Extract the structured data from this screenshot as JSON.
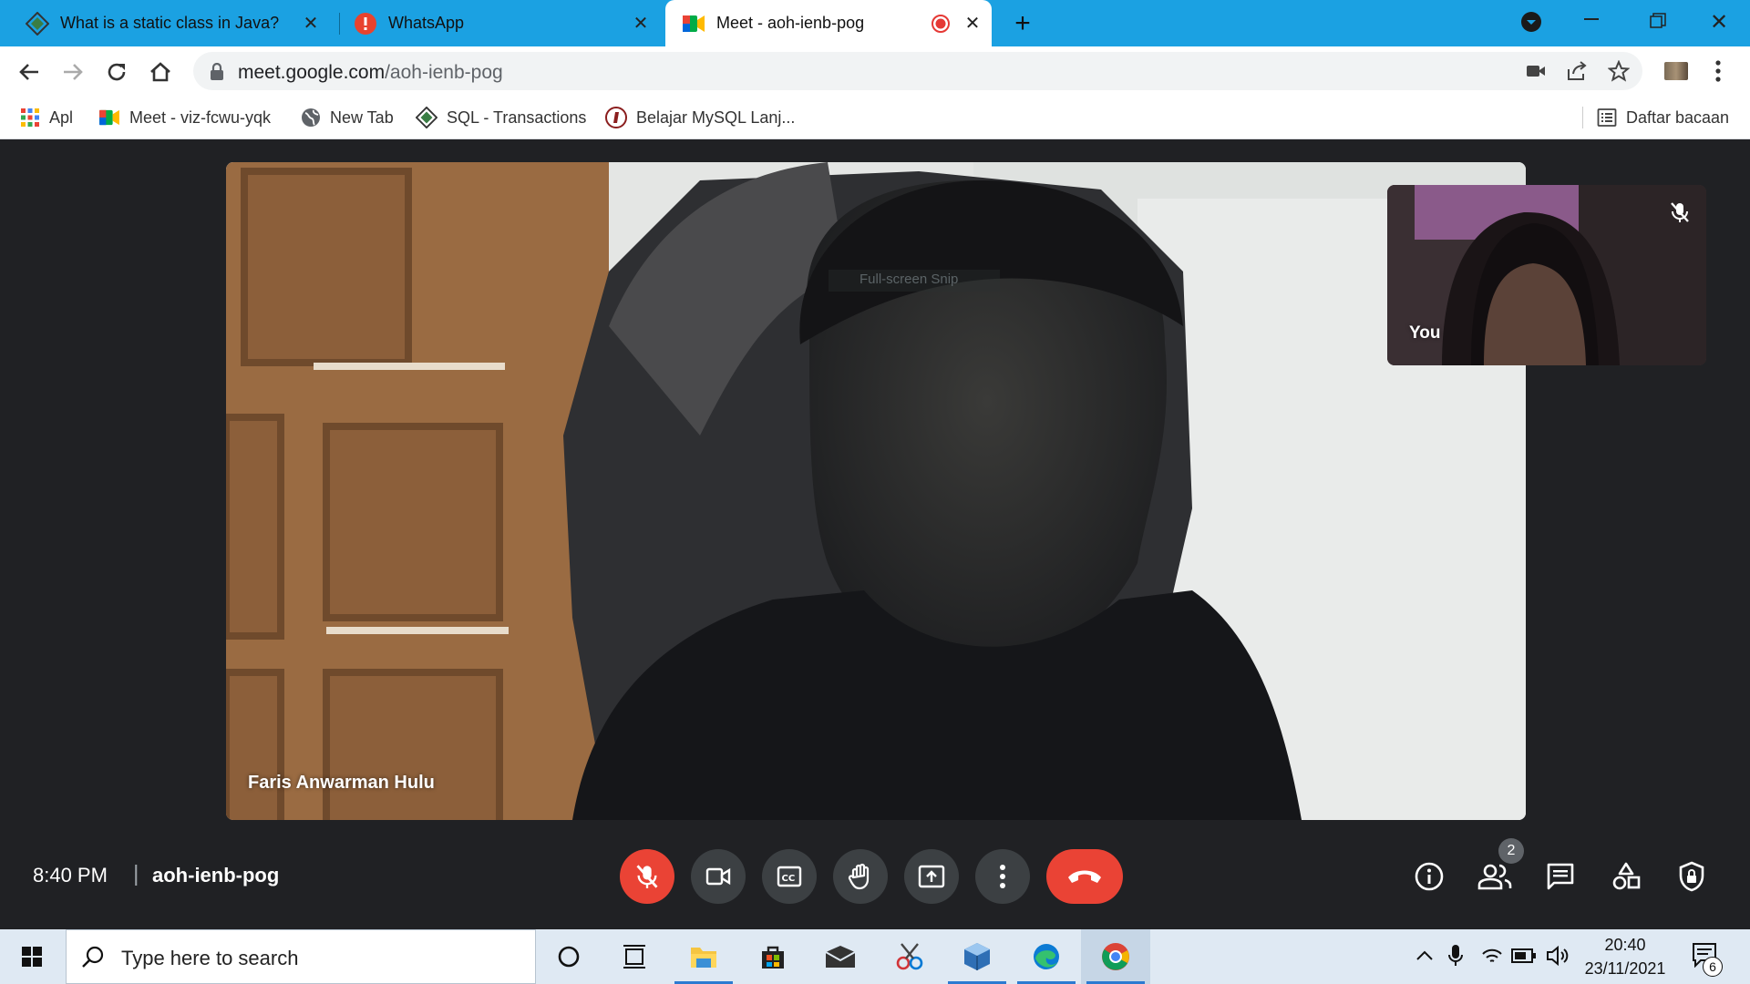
{
  "browser": {
    "tabs": [
      {
        "title": "What is a static class in Java?",
        "active": false
      },
      {
        "title": "WhatsApp",
        "active": false
      },
      {
        "title": "Meet - aoh-ienb-pog",
        "active": true,
        "recording": true
      }
    ],
    "new_tab_symbol": "+",
    "address": {
      "domain": "meet.google.com",
      "path": "/aoh-ienb-pog"
    },
    "bookmarks": [
      {
        "label": "Apl",
        "icon": "apps-grid-icon"
      },
      {
        "label": "Meet - viz-fcwu-yqk",
        "icon": "meet-icon"
      },
      {
        "label": "New Tab",
        "icon": "globe-icon"
      },
      {
        "label": "SQL - Transactions",
        "icon": "diamond-icon"
      },
      {
        "label": "Belajar MySQL Lanj...",
        "icon": "site-logo-icon"
      }
    ],
    "reading_list": "Daftar bacaan"
  },
  "meet": {
    "main_participant": "Faris Anwarman Hulu",
    "self_label": "You",
    "overlay_text": "Full-screen Snip",
    "time": "8:40 PM",
    "separator": "|",
    "meeting_code": "aoh-ienb-pog",
    "participants_count": "2",
    "colors": {
      "background": "#202124",
      "button": "#3c4043",
      "danger": "#ea4335"
    }
  },
  "taskbar": {
    "search_placeholder": "Type here to search",
    "clock_time": "20:40",
    "clock_date": "23/11/2021",
    "notification_count": "6"
  }
}
